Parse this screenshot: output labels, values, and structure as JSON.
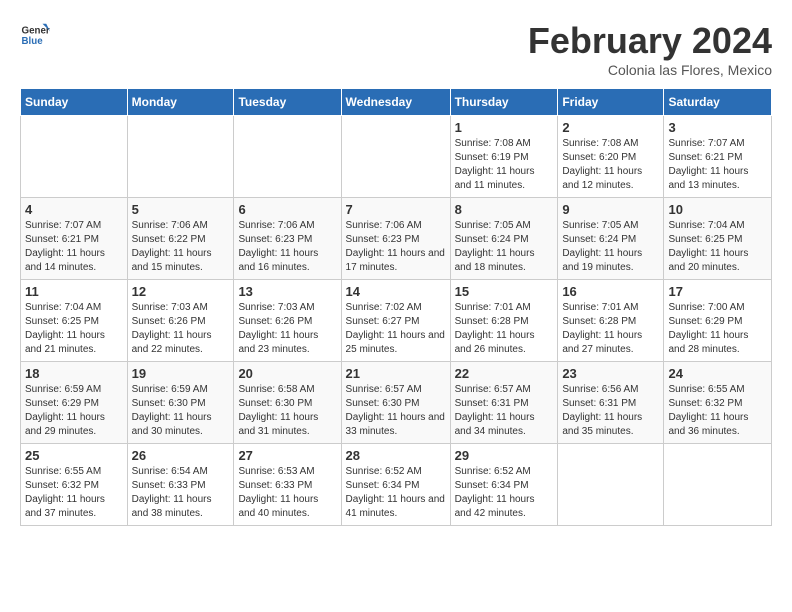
{
  "header": {
    "logo_general": "General",
    "logo_blue": "Blue",
    "main_title": "February 2024",
    "subtitle": "Colonia las Flores, Mexico"
  },
  "columns": [
    "Sunday",
    "Monday",
    "Tuesday",
    "Wednesday",
    "Thursday",
    "Friday",
    "Saturday"
  ],
  "weeks": [
    [
      {
        "day": "",
        "info": ""
      },
      {
        "day": "",
        "info": ""
      },
      {
        "day": "",
        "info": ""
      },
      {
        "day": "",
        "info": ""
      },
      {
        "day": "1",
        "info": "Sunrise: 7:08 AM\nSunset: 6:19 PM\nDaylight: 11 hours and 11 minutes."
      },
      {
        "day": "2",
        "info": "Sunrise: 7:08 AM\nSunset: 6:20 PM\nDaylight: 11 hours and 12 minutes."
      },
      {
        "day": "3",
        "info": "Sunrise: 7:07 AM\nSunset: 6:21 PM\nDaylight: 11 hours and 13 minutes."
      }
    ],
    [
      {
        "day": "4",
        "info": "Sunrise: 7:07 AM\nSunset: 6:21 PM\nDaylight: 11 hours and 14 minutes."
      },
      {
        "day": "5",
        "info": "Sunrise: 7:06 AM\nSunset: 6:22 PM\nDaylight: 11 hours and 15 minutes."
      },
      {
        "day": "6",
        "info": "Sunrise: 7:06 AM\nSunset: 6:23 PM\nDaylight: 11 hours and 16 minutes."
      },
      {
        "day": "7",
        "info": "Sunrise: 7:06 AM\nSunset: 6:23 PM\nDaylight: 11 hours and 17 minutes."
      },
      {
        "day": "8",
        "info": "Sunrise: 7:05 AM\nSunset: 6:24 PM\nDaylight: 11 hours and 18 minutes."
      },
      {
        "day": "9",
        "info": "Sunrise: 7:05 AM\nSunset: 6:24 PM\nDaylight: 11 hours and 19 minutes."
      },
      {
        "day": "10",
        "info": "Sunrise: 7:04 AM\nSunset: 6:25 PM\nDaylight: 11 hours and 20 minutes."
      }
    ],
    [
      {
        "day": "11",
        "info": "Sunrise: 7:04 AM\nSunset: 6:25 PM\nDaylight: 11 hours and 21 minutes."
      },
      {
        "day": "12",
        "info": "Sunrise: 7:03 AM\nSunset: 6:26 PM\nDaylight: 11 hours and 22 minutes."
      },
      {
        "day": "13",
        "info": "Sunrise: 7:03 AM\nSunset: 6:26 PM\nDaylight: 11 hours and 23 minutes."
      },
      {
        "day": "14",
        "info": "Sunrise: 7:02 AM\nSunset: 6:27 PM\nDaylight: 11 hours and 25 minutes."
      },
      {
        "day": "15",
        "info": "Sunrise: 7:01 AM\nSunset: 6:28 PM\nDaylight: 11 hours and 26 minutes."
      },
      {
        "day": "16",
        "info": "Sunrise: 7:01 AM\nSunset: 6:28 PM\nDaylight: 11 hours and 27 minutes."
      },
      {
        "day": "17",
        "info": "Sunrise: 7:00 AM\nSunset: 6:29 PM\nDaylight: 11 hours and 28 minutes."
      }
    ],
    [
      {
        "day": "18",
        "info": "Sunrise: 6:59 AM\nSunset: 6:29 PM\nDaylight: 11 hours and 29 minutes."
      },
      {
        "day": "19",
        "info": "Sunrise: 6:59 AM\nSunset: 6:30 PM\nDaylight: 11 hours and 30 minutes."
      },
      {
        "day": "20",
        "info": "Sunrise: 6:58 AM\nSunset: 6:30 PM\nDaylight: 11 hours and 31 minutes."
      },
      {
        "day": "21",
        "info": "Sunrise: 6:57 AM\nSunset: 6:30 PM\nDaylight: 11 hours and 33 minutes."
      },
      {
        "day": "22",
        "info": "Sunrise: 6:57 AM\nSunset: 6:31 PM\nDaylight: 11 hours and 34 minutes."
      },
      {
        "day": "23",
        "info": "Sunrise: 6:56 AM\nSunset: 6:31 PM\nDaylight: 11 hours and 35 minutes."
      },
      {
        "day": "24",
        "info": "Sunrise: 6:55 AM\nSunset: 6:32 PM\nDaylight: 11 hours and 36 minutes."
      }
    ],
    [
      {
        "day": "25",
        "info": "Sunrise: 6:55 AM\nSunset: 6:32 PM\nDaylight: 11 hours and 37 minutes."
      },
      {
        "day": "26",
        "info": "Sunrise: 6:54 AM\nSunset: 6:33 PM\nDaylight: 11 hours and 38 minutes."
      },
      {
        "day": "27",
        "info": "Sunrise: 6:53 AM\nSunset: 6:33 PM\nDaylight: 11 hours and 40 minutes."
      },
      {
        "day": "28",
        "info": "Sunrise: 6:52 AM\nSunset: 6:34 PM\nDaylight: 11 hours and 41 minutes."
      },
      {
        "day": "29",
        "info": "Sunrise: 6:52 AM\nSunset: 6:34 PM\nDaylight: 11 hours and 42 minutes."
      },
      {
        "day": "",
        "info": ""
      },
      {
        "day": "",
        "info": ""
      }
    ]
  ]
}
